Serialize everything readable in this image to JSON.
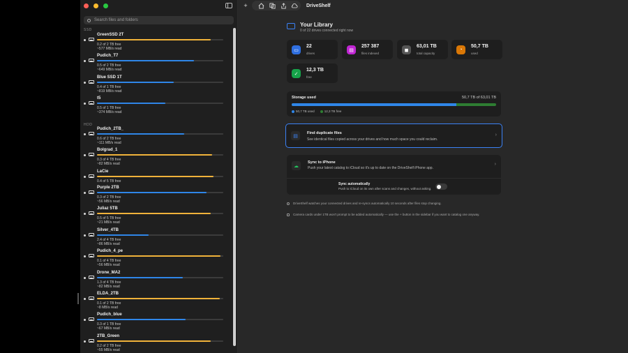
{
  "colors": {
    "accent_blue": "#2f86e8",
    "orange_bar": "#f0b23a",
    "green_free": "#2e7d32"
  },
  "sidebar": {
    "search_placeholder": "Search files and folders",
    "sections": {
      "ssd": "SSD",
      "hdd": "HDD"
    },
    "drives": [
      {
        "name": "GreenSSD 2T",
        "line1": "0.2 of 2 TB free",
        "line2": "~577 MB/s read",
        "used_fraction": 0.9,
        "color": "#f0b23a"
      },
      {
        "name": "Pudich_T7",
        "line1": "0.5 of 2 TB free",
        "line2": "~649 MB/s read",
        "used_fraction": 0.77,
        "color": "#2f86e8"
      },
      {
        "name": "Blue SSD 1T",
        "line1": "0.4 of 1 TB free",
        "line2": "~819 MB/s read",
        "used_fraction": 0.61,
        "color": "#2f86e8"
      },
      {
        "name": "t5",
        "line1": "0.5 of 1 TB free",
        "line2": "~374 MB/s read",
        "used_fraction": 0.54,
        "color": "#2f86e8"
      },
      {
        "name": "Pudich_2TB_",
        "line1": "0.6 of 2 TB free",
        "line2": "~111 MB/s read",
        "used_fraction": 0.69,
        "color": "#2f86e8"
      },
      {
        "name": "Bolgrad_1",
        "line1": "0.3 of 4 TB free",
        "line2": "~82 MB/s read",
        "used_fraction": 0.91,
        "color": "#f0b23a"
      },
      {
        "name": "LaCie",
        "line1": "0.4 of 5 TB free",
        "line2": "",
        "used_fraction": 0.92,
        "color": "#f0b23a"
      },
      {
        "name": "Purple 2TB",
        "line1": "0.3 of 2 TB free",
        "line2": "~56 MB/s read",
        "used_fraction": 0.87,
        "color": "#2f86e8"
      },
      {
        "name": "Juliaz 5TB",
        "line1": "0.5 of 5 TB free",
        "line2": "~21 MB/s read",
        "used_fraction": 0.9,
        "color": "#f0b23a"
      },
      {
        "name": "Silver_4TB",
        "line1": "2.4 of 4 TB free",
        "line2": "~86 MB/s read",
        "used_fraction": 0.41,
        "color": "#2f86e8"
      },
      {
        "name": "Pudich_4_pe",
        "line1": "0.1 of 4 TB free",
        "line2": "~56 MB/s read",
        "used_fraction": 0.98,
        "color": "#f0b23a"
      },
      {
        "name": "Drone_MA2",
        "line1": "1.3 of 4 TB free",
        "line2": "~82 MB/s read",
        "used_fraction": 0.68,
        "color": "#2f86e8"
      },
      {
        "name": "ELDA_2TB",
        "line1": "0.1 of 2 TB free",
        "line2": "~8 MB/s read",
        "used_fraction": 0.97,
        "color": "#f0b23a"
      },
      {
        "name": "Pudich_blue",
        "line1": "0.3 of 1 TB free",
        "line2": "~67 MB/s read",
        "used_fraction": 0.7,
        "color": "#2f86e8"
      },
      {
        "name": "2TB_Green",
        "line1": "0.2 of 2 TB free",
        "line2": "~55 MB/s read",
        "used_fraction": 0.9,
        "color": "#f0b23a"
      }
    ]
  },
  "toolbar": {
    "title": "DriveShelf",
    "add": "+"
  },
  "library": {
    "title": "Your Library",
    "subtitle": "0 of 22 drives connected right now",
    "stats": [
      {
        "value": "22",
        "label": "drives",
        "color": "#2f6fe0",
        "icon": "drive-icon"
      },
      {
        "value": "257 387",
        "label": "files indexed",
        "color": "#c026d3",
        "icon": "document-icon"
      },
      {
        "value": "63,01 TB",
        "label": "total capacity",
        "color": "#555555",
        "icon": "disk-icon"
      },
      {
        "value": "50,7 TB",
        "label": "used",
        "color": "#d97706",
        "icon": "pie-icon"
      },
      {
        "value": "12,3 TB",
        "label": "free",
        "color": "#16a34a",
        "icon": "check-icon"
      }
    ]
  },
  "storage": {
    "title": "Storage used",
    "summary": "50,7 TB of 63,01 TB",
    "used_fraction": 0.805,
    "legend_used": "50,7 TB used",
    "legend_free": "12,3 TB free"
  },
  "duplicates": {
    "title": "Find duplicate files",
    "desc": "See identical files copied across your drives and how much space you could reclaim."
  },
  "sync": {
    "title": "Sync to iPhone",
    "desc": "Push your latest catalog to iCloud so it's up to date on the DriveShelf iPhone app.",
    "auto_title": "Sync automatically",
    "auto_desc": "Push to iCloud on its own after scans and changes, without asking.",
    "auto_on": false
  },
  "notes": [
    "DriveShelf watches your connected drives and re-syncs automatically 10 seconds after files stop changing.",
    "Camera cards under 1TB won't prompt to be added automatically — use the + button in the sidebar if you want to catalog one anyway."
  ]
}
